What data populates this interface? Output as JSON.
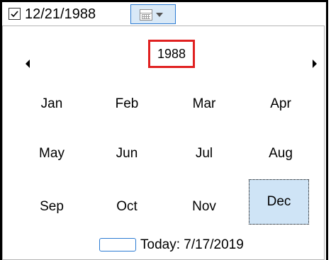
{
  "date_picker": {
    "checked": true,
    "value": "12/21/1988",
    "icons": {
      "checkbox": "checkbox-icon",
      "calendar": "calendar-icon",
      "dropdown": "chevron-down-icon"
    }
  },
  "calendar": {
    "year": "1988",
    "prev_icon": "chevron-left-icon",
    "next_icon": "chevron-right-icon",
    "months": [
      "Jan",
      "Feb",
      "Mar",
      "Apr",
      "May",
      "Jun",
      "Jul",
      "Aug",
      "Sep",
      "Oct",
      "Nov",
      "Dec"
    ],
    "selected_month": "Dec",
    "today_label": "Today: 7/17/2019"
  },
  "colors": {
    "selection": "#cfe4f6",
    "highlight_border": "#e02020",
    "accent": "#2b7bd3"
  }
}
